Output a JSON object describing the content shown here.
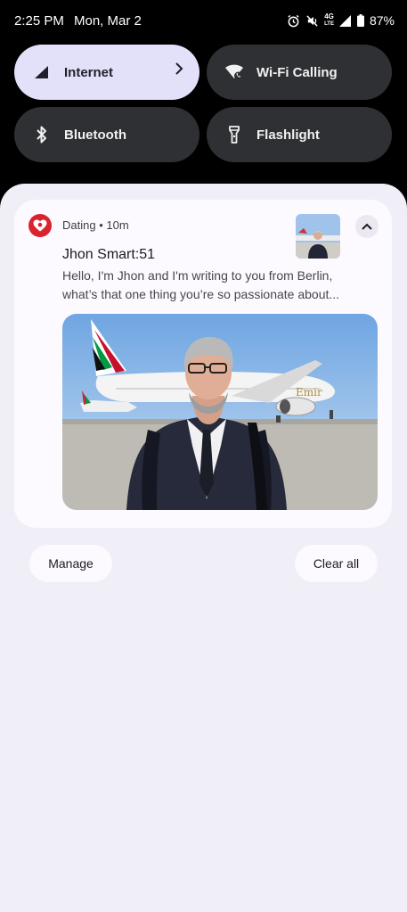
{
  "status_bar": {
    "time": "2:25 PM",
    "date": "Mon, Mar 2",
    "network_label": "4G",
    "network_sub": "LTE",
    "battery": "87%",
    "icons": [
      "alarm-icon",
      "mute-icon",
      "signal-icon",
      "battery-icon"
    ]
  },
  "quick_settings": {
    "tiles": [
      {
        "label": "Internet",
        "icon": "signal-icon",
        "state": "on",
        "has_chevron": true
      },
      {
        "label": "Wi-Fi Calling",
        "icon": "wifi-calling-icon",
        "state": "off"
      },
      {
        "label": "Bluetooth",
        "icon": "bluetooth-icon",
        "state": "off"
      },
      {
        "label": "Flashlight",
        "icon": "flashlight-icon",
        "state": "off"
      }
    ]
  },
  "notification": {
    "app_name": "Dating",
    "separator": "•",
    "time_ago": "10m",
    "app_icon": "heart-icon",
    "title": "Jhon Smart:51",
    "body": "Hello, I'm Jhon and I'm writing to you from Berlin, what’s that one thing you’re so passionate about...",
    "accent_color": "#d9232e"
  },
  "actions": {
    "manage_label": "Manage",
    "clear_all_label": "Clear all"
  }
}
